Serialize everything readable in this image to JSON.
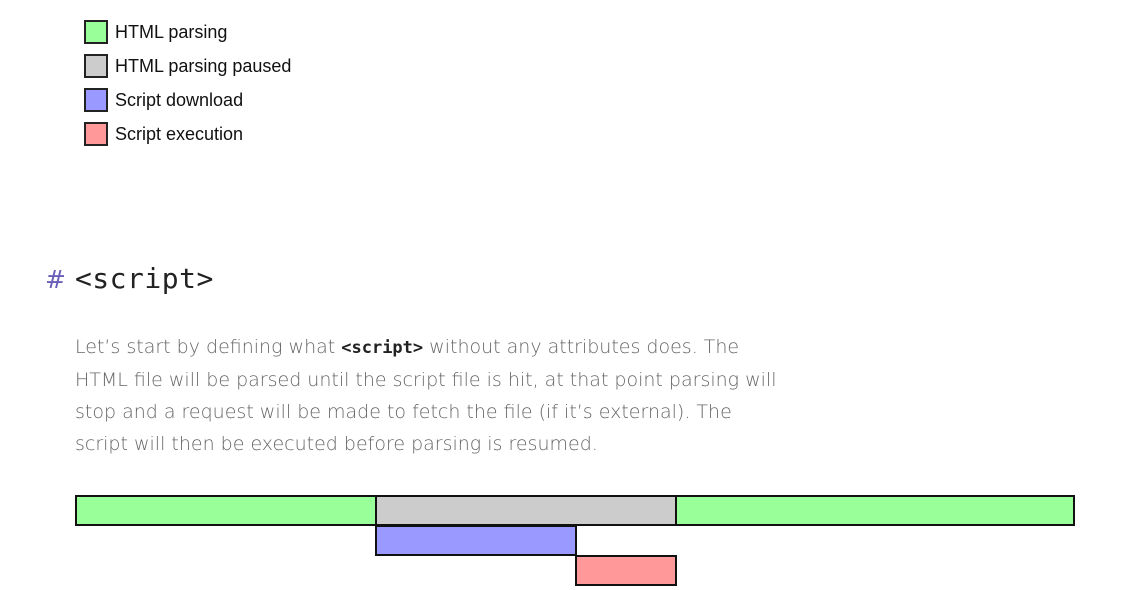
{
  "legend": {
    "items": [
      {
        "label": "HTML parsing",
        "color": "#99ff99"
      },
      {
        "label": "HTML parsing paused",
        "color": "#cccccc"
      },
      {
        "label": "Script download",
        "color": "#9999ff"
      },
      {
        "label": "Script execution",
        "color": "#ff9999"
      }
    ]
  },
  "section": {
    "anchor": "#",
    "heading": "<script>",
    "paragraph": {
      "before_code": "Let’s start by defining what ",
      "code": "<script>",
      "after_code": " without any attributes does. The HTML file will be parsed until the script file is hit, at that point parsing will stop and a request will be made to fetch the file (if it’s external). The script will then be executed before parsing is resumed."
    }
  },
  "timeline": {
    "segments": [
      {
        "phase": "HTML parsing",
        "color": "#99ff99"
      },
      {
        "phase": "HTML parsing paused",
        "color": "#cccccc"
      },
      {
        "phase": "HTML parsing",
        "color": "#99ff99"
      },
      {
        "phase": "Script download",
        "color": "#9999ff"
      },
      {
        "phase": "Script execution",
        "color": "#ff9999"
      }
    ]
  }
}
